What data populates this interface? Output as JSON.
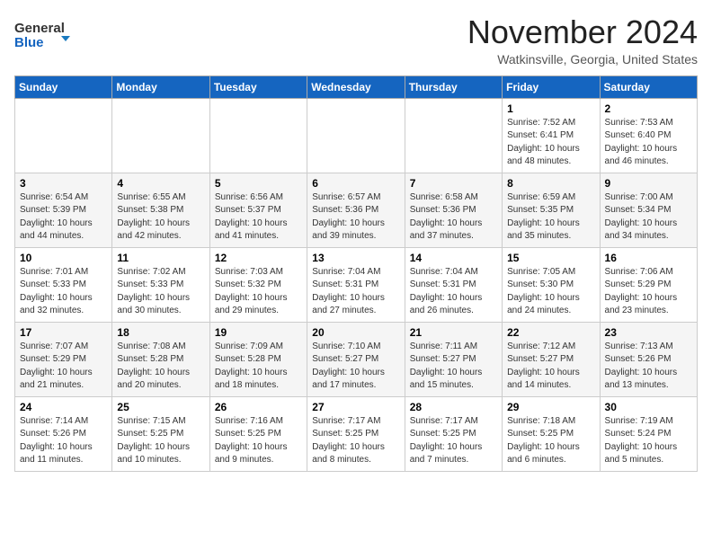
{
  "header": {
    "logo_general": "General",
    "logo_blue": "Blue",
    "month_year": "November 2024",
    "location": "Watkinsville, Georgia, United States"
  },
  "weekdays": [
    "Sunday",
    "Monday",
    "Tuesday",
    "Wednesday",
    "Thursday",
    "Friday",
    "Saturday"
  ],
  "weeks": [
    [
      {
        "day": "",
        "info": ""
      },
      {
        "day": "",
        "info": ""
      },
      {
        "day": "",
        "info": ""
      },
      {
        "day": "",
        "info": ""
      },
      {
        "day": "",
        "info": ""
      },
      {
        "day": "1",
        "info": "Sunrise: 7:52 AM\nSunset: 6:41 PM\nDaylight: 10 hours and 48 minutes."
      },
      {
        "day": "2",
        "info": "Sunrise: 7:53 AM\nSunset: 6:40 PM\nDaylight: 10 hours and 46 minutes."
      }
    ],
    [
      {
        "day": "3",
        "info": "Sunrise: 6:54 AM\nSunset: 5:39 PM\nDaylight: 10 hours and 44 minutes."
      },
      {
        "day": "4",
        "info": "Sunrise: 6:55 AM\nSunset: 5:38 PM\nDaylight: 10 hours and 42 minutes."
      },
      {
        "day": "5",
        "info": "Sunrise: 6:56 AM\nSunset: 5:37 PM\nDaylight: 10 hours and 41 minutes."
      },
      {
        "day": "6",
        "info": "Sunrise: 6:57 AM\nSunset: 5:36 PM\nDaylight: 10 hours and 39 minutes."
      },
      {
        "day": "7",
        "info": "Sunrise: 6:58 AM\nSunset: 5:36 PM\nDaylight: 10 hours and 37 minutes."
      },
      {
        "day": "8",
        "info": "Sunrise: 6:59 AM\nSunset: 5:35 PM\nDaylight: 10 hours and 35 minutes."
      },
      {
        "day": "9",
        "info": "Sunrise: 7:00 AM\nSunset: 5:34 PM\nDaylight: 10 hours and 34 minutes."
      }
    ],
    [
      {
        "day": "10",
        "info": "Sunrise: 7:01 AM\nSunset: 5:33 PM\nDaylight: 10 hours and 32 minutes."
      },
      {
        "day": "11",
        "info": "Sunrise: 7:02 AM\nSunset: 5:33 PM\nDaylight: 10 hours and 30 minutes."
      },
      {
        "day": "12",
        "info": "Sunrise: 7:03 AM\nSunset: 5:32 PM\nDaylight: 10 hours and 29 minutes."
      },
      {
        "day": "13",
        "info": "Sunrise: 7:04 AM\nSunset: 5:31 PM\nDaylight: 10 hours and 27 minutes."
      },
      {
        "day": "14",
        "info": "Sunrise: 7:04 AM\nSunset: 5:31 PM\nDaylight: 10 hours and 26 minutes."
      },
      {
        "day": "15",
        "info": "Sunrise: 7:05 AM\nSunset: 5:30 PM\nDaylight: 10 hours and 24 minutes."
      },
      {
        "day": "16",
        "info": "Sunrise: 7:06 AM\nSunset: 5:29 PM\nDaylight: 10 hours and 23 minutes."
      }
    ],
    [
      {
        "day": "17",
        "info": "Sunrise: 7:07 AM\nSunset: 5:29 PM\nDaylight: 10 hours and 21 minutes."
      },
      {
        "day": "18",
        "info": "Sunrise: 7:08 AM\nSunset: 5:28 PM\nDaylight: 10 hours and 20 minutes."
      },
      {
        "day": "19",
        "info": "Sunrise: 7:09 AM\nSunset: 5:28 PM\nDaylight: 10 hours and 18 minutes."
      },
      {
        "day": "20",
        "info": "Sunrise: 7:10 AM\nSunset: 5:27 PM\nDaylight: 10 hours and 17 minutes."
      },
      {
        "day": "21",
        "info": "Sunrise: 7:11 AM\nSunset: 5:27 PM\nDaylight: 10 hours and 15 minutes."
      },
      {
        "day": "22",
        "info": "Sunrise: 7:12 AM\nSunset: 5:27 PM\nDaylight: 10 hours and 14 minutes."
      },
      {
        "day": "23",
        "info": "Sunrise: 7:13 AM\nSunset: 5:26 PM\nDaylight: 10 hours and 13 minutes."
      }
    ],
    [
      {
        "day": "24",
        "info": "Sunrise: 7:14 AM\nSunset: 5:26 PM\nDaylight: 10 hours and 11 minutes."
      },
      {
        "day": "25",
        "info": "Sunrise: 7:15 AM\nSunset: 5:25 PM\nDaylight: 10 hours and 10 minutes."
      },
      {
        "day": "26",
        "info": "Sunrise: 7:16 AM\nSunset: 5:25 PM\nDaylight: 10 hours and 9 minutes."
      },
      {
        "day": "27",
        "info": "Sunrise: 7:17 AM\nSunset: 5:25 PM\nDaylight: 10 hours and 8 minutes."
      },
      {
        "day": "28",
        "info": "Sunrise: 7:17 AM\nSunset: 5:25 PM\nDaylight: 10 hours and 7 minutes."
      },
      {
        "day": "29",
        "info": "Sunrise: 7:18 AM\nSunset: 5:25 PM\nDaylight: 10 hours and 6 minutes."
      },
      {
        "day": "30",
        "info": "Sunrise: 7:19 AM\nSunset: 5:24 PM\nDaylight: 10 hours and 5 minutes."
      }
    ]
  ]
}
